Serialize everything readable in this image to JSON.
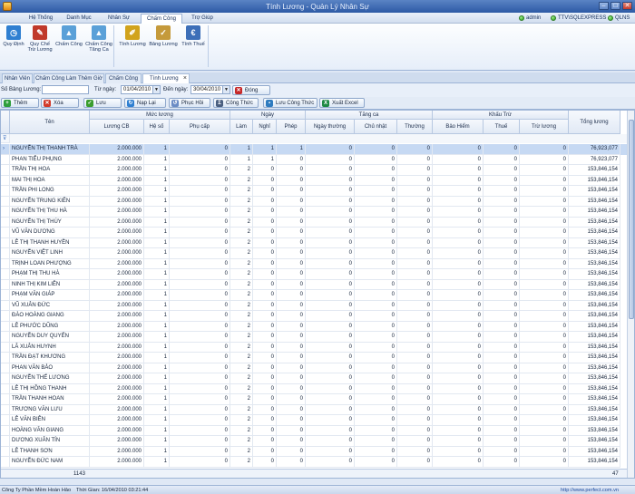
{
  "window": {
    "title": "Tính Lương - Quản Lý Nhân Sự",
    "min": "–",
    "max": "□",
    "close": "✕"
  },
  "menu": {
    "tabs": [
      "Hệ Thống",
      "Danh Mục",
      "Nhân Sự",
      "Chấm Công",
      "Trợ Giúp"
    ],
    "active": 3
  },
  "user": {
    "name": "admin",
    "server": "TTV\\SQLEXPRESS",
    "db": "QLNS"
  },
  "ribbon": {
    "items": [
      {
        "label": "Quy Định",
        "icon": "clock-icon",
        "color": "#2f7fd1",
        "glyph": "◷"
      },
      {
        "label": "Quy Chế Trừ Lương",
        "icon": "pin-icon",
        "color": "#c0392b",
        "glyph": "✎"
      },
      {
        "label": "Chấm Công",
        "icon": "triangle-icon",
        "color": "#5aa0d8",
        "glyph": "▲"
      },
      {
        "label": "Chấm Công Tăng Ca",
        "icon": "triangle-icon",
        "color": "#5aa0d8",
        "glyph": "▲"
      },
      {
        "label": "Tính Lương",
        "icon": "salary-icon",
        "color": "#d1a31c",
        "glyph": "✐"
      },
      {
        "label": "Bảng Lương",
        "icon": "sheet-icon",
        "color": "#c59a3b",
        "glyph": "✓"
      },
      {
        "label": "Tính Thuế",
        "icon": "tax-icon",
        "color": "#3d6fb8",
        "glyph": "€"
      }
    ]
  },
  "doc_tabs": [
    "Nhân Viên",
    "Chấm Công Làm Thêm Giờ",
    "Chấm Công",
    "Tính Lương"
  ],
  "doc_tab_active": 3,
  "filter": {
    "label_code": "Số Bảng Lương:",
    "code_value": "",
    "label_from": "Từ ngày:",
    "from": "01/04/2010",
    "label_to": "Đến ngày:",
    "to": "30/04/2010",
    "close_btn": "Đóng"
  },
  "toolbar": [
    "Thêm",
    "Xóa",
    "Lưu",
    "Nạp Lại",
    "Phục Hồi",
    "Công Thức",
    "Lưu Công Thức",
    "Xuất Excel"
  ],
  "grid": {
    "groups": [
      "Mức lương",
      "Ngày",
      "Tăng ca",
      "Khấu Trừ"
    ],
    "columns": [
      "Tên",
      "Lương CB",
      "Hệ số",
      "Phụ cấp",
      "Làm",
      "Nghỉ",
      "Phép",
      "Ngày thường",
      "Chủ nhật",
      "Thường",
      "Bảo Hiểm",
      "Thuế",
      "Trừ lương",
      "Tổng lương"
    ],
    "rows": [
      {
        "name": "NGUYỄN THỊ THANH TRÀ",
        "lcb": "2.000.000",
        "hs": "1",
        "pc": "0",
        "lam": "1",
        "nghi": "1",
        "phep": "1",
        "nt": "0",
        "cn": "0",
        "th": "0",
        "bh": "0",
        "thue": "0",
        "tl": "0",
        "tong": "76,923,077"
      },
      {
        "name": "PHAN TIỂU PHỤNG",
        "lcb": "2.000.000",
        "hs": "1",
        "pc": "0",
        "lam": "1",
        "nghi": "1",
        "phep": "0",
        "nt": "0",
        "cn": "0",
        "th": "0",
        "bh": "0",
        "thue": "0",
        "tl": "0",
        "tong": "76,923,077"
      },
      {
        "name": "TRẦN THỊ HOA",
        "lcb": "2.000.000",
        "hs": "1",
        "pc": "0",
        "lam": "2",
        "nghi": "0",
        "phep": "0",
        "nt": "0",
        "cn": "0",
        "th": "0",
        "bh": "0",
        "thue": "0",
        "tl": "0",
        "tong": "153,846,154"
      },
      {
        "name": "MAI THỊ HOA",
        "lcb": "2.000.000",
        "hs": "1",
        "pc": "0",
        "lam": "2",
        "nghi": "0",
        "phep": "0",
        "nt": "0",
        "cn": "0",
        "th": "0",
        "bh": "0",
        "thue": "0",
        "tl": "0",
        "tong": "153,846,154"
      },
      {
        "name": "TRẦN PHI LONG",
        "lcb": "2.000.000",
        "hs": "1",
        "pc": "0",
        "lam": "2",
        "nghi": "0",
        "phep": "0",
        "nt": "0",
        "cn": "0",
        "th": "0",
        "bh": "0",
        "thue": "0",
        "tl": "0",
        "tong": "153,846,154"
      },
      {
        "name": "NGUYỄN TRUNG KIÊN",
        "lcb": "2.000.000",
        "hs": "1",
        "pc": "0",
        "lam": "2",
        "nghi": "0",
        "phep": "0",
        "nt": "0",
        "cn": "0",
        "th": "0",
        "bh": "0",
        "thue": "0",
        "tl": "0",
        "tong": "153,846,154"
      },
      {
        "name": "NGUYỄN THỊ THU HÀ",
        "lcb": "2.000.000",
        "hs": "1",
        "pc": "0",
        "lam": "2",
        "nghi": "0",
        "phep": "0",
        "nt": "0",
        "cn": "0",
        "th": "0",
        "bh": "0",
        "thue": "0",
        "tl": "0",
        "tong": "153,846,154"
      },
      {
        "name": "NGUYỄN THỊ THÚY",
        "lcb": "2.000.000",
        "hs": "1",
        "pc": "0",
        "lam": "2",
        "nghi": "0",
        "phep": "0",
        "nt": "0",
        "cn": "0",
        "th": "0",
        "bh": "0",
        "thue": "0",
        "tl": "0",
        "tong": "153,846,154"
      },
      {
        "name": "VŨ VĂN DƯƠNG",
        "lcb": "2.000.000",
        "hs": "1",
        "pc": "0",
        "lam": "2",
        "nghi": "0",
        "phep": "0",
        "nt": "0",
        "cn": "0",
        "th": "0",
        "bh": "0",
        "thue": "0",
        "tl": "0",
        "tong": "153,846,154"
      },
      {
        "name": "LÊ THỊ THANH HUYỀN",
        "lcb": "2.000.000",
        "hs": "1",
        "pc": "0",
        "lam": "2",
        "nghi": "0",
        "phep": "0",
        "nt": "0",
        "cn": "0",
        "th": "0",
        "bh": "0",
        "thue": "0",
        "tl": "0",
        "tong": "153,846,154"
      },
      {
        "name": "NGUYỄN VIỆT LINH",
        "lcb": "2.000.000",
        "hs": "1",
        "pc": "0",
        "lam": "2",
        "nghi": "0",
        "phep": "0",
        "nt": "0",
        "cn": "0",
        "th": "0",
        "bh": "0",
        "thue": "0",
        "tl": "0",
        "tong": "153,846,154"
      },
      {
        "name": "TRỊNH LOAN PHƯỢNG",
        "lcb": "2.000.000",
        "hs": "1",
        "pc": "0",
        "lam": "2",
        "nghi": "0",
        "phep": "0",
        "nt": "0",
        "cn": "0",
        "th": "0",
        "bh": "0",
        "thue": "0",
        "tl": "0",
        "tong": "153,846,154"
      },
      {
        "name": "PHẠM THỊ THU HÀ",
        "lcb": "2.000.000",
        "hs": "1",
        "pc": "0",
        "lam": "2",
        "nghi": "0",
        "phep": "0",
        "nt": "0",
        "cn": "0",
        "th": "0",
        "bh": "0",
        "thue": "0",
        "tl": "0",
        "tong": "153,846,154"
      },
      {
        "name": "NINH THỊ KIM LIÊN",
        "lcb": "2.000.000",
        "hs": "1",
        "pc": "0",
        "lam": "2",
        "nghi": "0",
        "phep": "0",
        "nt": "0",
        "cn": "0",
        "th": "0",
        "bh": "0",
        "thue": "0",
        "tl": "0",
        "tong": "153,846,154"
      },
      {
        "name": "PHẠM VĂN GIÁP",
        "lcb": "2.000.000",
        "hs": "1",
        "pc": "0",
        "lam": "2",
        "nghi": "0",
        "phep": "0",
        "nt": "0",
        "cn": "0",
        "th": "0",
        "bh": "0",
        "thue": "0",
        "tl": "0",
        "tong": "153,846,154"
      },
      {
        "name": "VŨ XUÂN ĐỨC",
        "lcb": "2.000.000",
        "hs": "1",
        "pc": "0",
        "lam": "2",
        "nghi": "0",
        "phep": "0",
        "nt": "0",
        "cn": "0",
        "th": "0",
        "bh": "0",
        "thue": "0",
        "tl": "0",
        "tong": "153,846,154"
      },
      {
        "name": "ĐÀO HOÀNG GIANG",
        "lcb": "2.000.000",
        "hs": "1",
        "pc": "0",
        "lam": "2",
        "nghi": "0",
        "phep": "0",
        "nt": "0",
        "cn": "0",
        "th": "0",
        "bh": "0",
        "thue": "0",
        "tl": "0",
        "tong": "153,846,154"
      },
      {
        "name": "LÊ PHƯỚC DŨNG",
        "lcb": "2.000.000",
        "hs": "1",
        "pc": "0",
        "lam": "2",
        "nghi": "0",
        "phep": "0",
        "nt": "0",
        "cn": "0",
        "th": "0",
        "bh": "0",
        "thue": "0",
        "tl": "0",
        "tong": "153,846,154"
      },
      {
        "name": "NGUYỄN DUY QUYẾN",
        "lcb": "2.000.000",
        "hs": "1",
        "pc": "0",
        "lam": "2",
        "nghi": "0",
        "phep": "0",
        "nt": "0",
        "cn": "0",
        "th": "0",
        "bh": "0",
        "thue": "0",
        "tl": "0",
        "tong": "153,846,154"
      },
      {
        "name": "LÃ XUÂN HUYNH",
        "lcb": "2.000.000",
        "hs": "1",
        "pc": "0",
        "lam": "2",
        "nghi": "0",
        "phep": "0",
        "nt": "0",
        "cn": "0",
        "th": "0",
        "bh": "0",
        "thue": "0",
        "tl": "0",
        "tong": "153,846,154"
      },
      {
        "name": "TRẦN ĐẠT KHƯƠNG",
        "lcb": "2.000.000",
        "hs": "1",
        "pc": "0",
        "lam": "2",
        "nghi": "0",
        "phep": "0",
        "nt": "0",
        "cn": "0",
        "th": "0",
        "bh": "0",
        "thue": "0",
        "tl": "0",
        "tong": "153,846,154"
      },
      {
        "name": "PHAN VĂN BẢO",
        "lcb": "2.000.000",
        "hs": "1",
        "pc": "0",
        "lam": "2",
        "nghi": "0",
        "phep": "0",
        "nt": "0",
        "cn": "0",
        "th": "0",
        "bh": "0",
        "thue": "0",
        "tl": "0",
        "tong": "153,846,154"
      },
      {
        "name": "NGUYỄN THẾ LƯƠNG",
        "lcb": "2.000.000",
        "hs": "1",
        "pc": "0",
        "lam": "2",
        "nghi": "0",
        "phep": "0",
        "nt": "0",
        "cn": "0",
        "th": "0",
        "bh": "0",
        "thue": "0",
        "tl": "0",
        "tong": "153,846,154"
      },
      {
        "name": "LÊ THỊ HỒNG THANH",
        "lcb": "2.000.000",
        "hs": "1",
        "pc": "0",
        "lam": "2",
        "nghi": "0",
        "phep": "0",
        "nt": "0",
        "cn": "0",
        "th": "0",
        "bh": "0",
        "thue": "0",
        "tl": "0",
        "tong": "153,846,154"
      },
      {
        "name": "TRẦN THANH HOAN",
        "lcb": "2.000.000",
        "hs": "1",
        "pc": "0",
        "lam": "2",
        "nghi": "0",
        "phep": "0",
        "nt": "0",
        "cn": "0",
        "th": "0",
        "bh": "0",
        "thue": "0",
        "tl": "0",
        "tong": "153,846,154"
      },
      {
        "name": "TRƯƠNG VĂN LƯU",
        "lcb": "2.000.000",
        "hs": "1",
        "pc": "0",
        "lam": "2",
        "nghi": "0",
        "phep": "0",
        "nt": "0",
        "cn": "0",
        "th": "0",
        "bh": "0",
        "thue": "0",
        "tl": "0",
        "tong": "153,846,154"
      },
      {
        "name": "LÊ VĂN BIÊN",
        "lcb": "2.000.000",
        "hs": "1",
        "pc": "0",
        "lam": "2",
        "nghi": "0",
        "phep": "0",
        "nt": "0",
        "cn": "0",
        "th": "0",
        "bh": "0",
        "thue": "0",
        "tl": "0",
        "tong": "153,846,154"
      },
      {
        "name": "HOÀNG VĂN GIANG",
        "lcb": "2.000.000",
        "hs": "1",
        "pc": "0",
        "lam": "2",
        "nghi": "0",
        "phep": "0",
        "nt": "0",
        "cn": "0",
        "th": "0",
        "bh": "0",
        "thue": "0",
        "tl": "0",
        "tong": "153,846,154"
      },
      {
        "name": "DƯƠNG XUÂN TÍN",
        "lcb": "2.000.000",
        "hs": "1",
        "pc": "0",
        "lam": "2",
        "nghi": "0",
        "phep": "0",
        "nt": "0",
        "cn": "0",
        "th": "0",
        "bh": "0",
        "thue": "0",
        "tl": "0",
        "tong": "153,846,154"
      },
      {
        "name": "LÊ THANH SƠN",
        "lcb": "2.000.000",
        "hs": "1",
        "pc": "0",
        "lam": "2",
        "nghi": "0",
        "phep": "0",
        "nt": "0",
        "cn": "0",
        "th": "0",
        "bh": "0",
        "thue": "0",
        "tl": "0",
        "tong": "153,846,154"
      },
      {
        "name": "NGUYỄN ĐỨC NAM",
        "lcb": "2.000.000",
        "hs": "1",
        "pc": "0",
        "lam": "2",
        "nghi": "0",
        "phep": "0",
        "nt": "0",
        "cn": "0",
        "th": "0",
        "bh": "0",
        "thue": "0",
        "tl": "0",
        "tong": "153,846,154"
      }
    ],
    "footer_left": "1143",
    "footer_right": "47"
  },
  "status": {
    "company": "Công Ty Phần Mềm Hoàn Hảo",
    "time": "Thời Gian: 16/04/2010 03:21:44",
    "url": "http://www.perfect.com.vn"
  },
  "colors": {
    "accent": "#2d5aa5",
    "selected_row": "#c6d9f3"
  }
}
